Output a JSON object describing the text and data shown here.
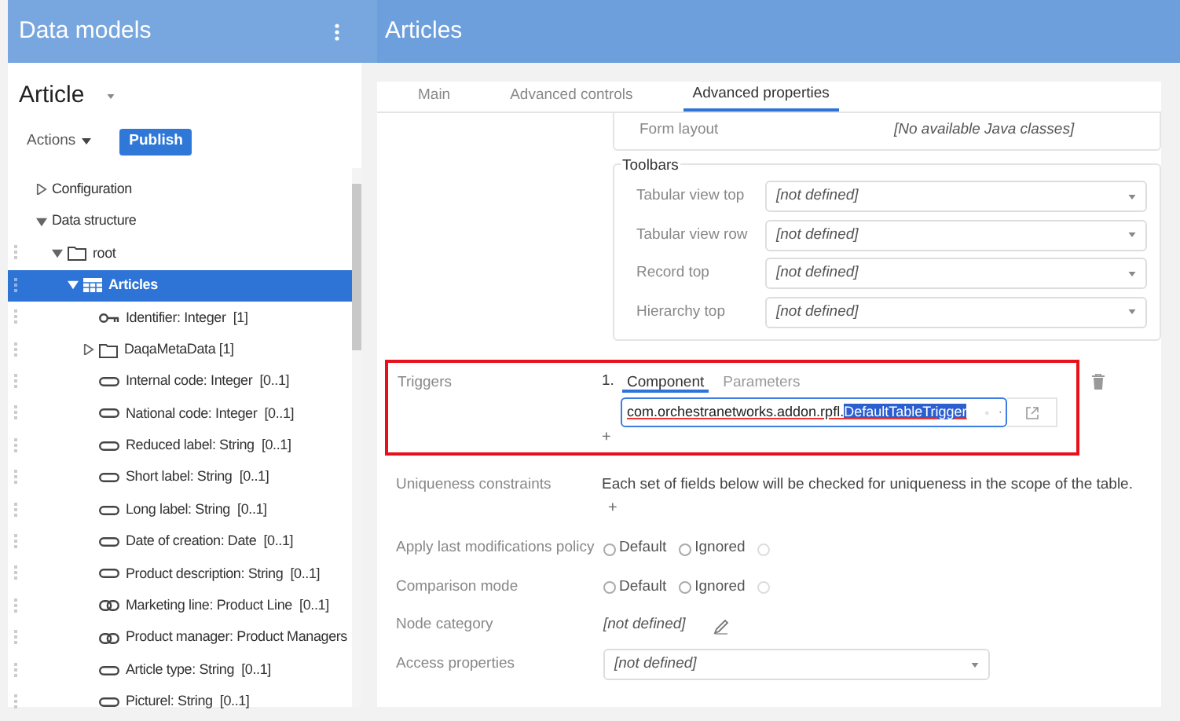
{
  "sidebar": {
    "title": "Data models",
    "model": {
      "name": "Article"
    },
    "actions": {
      "label": "Actions"
    },
    "publish": {
      "label": "Publish"
    },
    "tree": [
      {
        "label": "Configuration",
        "kind": "group",
        "expanded": false,
        "selected": false
      },
      {
        "label": "Data structure",
        "kind": "group",
        "expanded": true,
        "selected": false,
        "children": [
          {
            "label": "root",
            "kind": "folder",
            "expanded": true,
            "selected": false,
            "children": [
              {
                "label": "Articles",
                "kind": "table",
                "expanded": true,
                "selected": true,
                "children": [
                  {
                    "label": "Identifier: Integer  [1]",
                    "kind": "key",
                    "selected": false
                  },
                  {
                    "label": "DaqaMetaData [1]",
                    "kind": "folder",
                    "expanded": false,
                    "selected": false
                  },
                  {
                    "label": "Internal code: Integer  [0..1]",
                    "kind": "field",
                    "selected": false
                  },
                  {
                    "label": "National code: Integer  [0..1]",
                    "kind": "field",
                    "selected": false
                  },
                  {
                    "label": "Reduced label: String  [0..1]",
                    "kind": "field",
                    "selected": false
                  },
                  {
                    "label": "Short label: String  [0..1]",
                    "kind": "field",
                    "selected": false
                  },
                  {
                    "label": "Long label: String  [0..1]",
                    "kind": "field",
                    "selected": false
                  },
                  {
                    "label": "Date of creation: Date  [0..1]",
                    "kind": "field",
                    "selected": false
                  },
                  {
                    "label": "Product description: String  [0..1]",
                    "kind": "field",
                    "selected": false
                  },
                  {
                    "label": "Marketing line: Product Line  [0..1]",
                    "kind": "link",
                    "selected": false
                  },
                  {
                    "label": "Product manager: Product Managers",
                    "kind": "link",
                    "selected": false
                  },
                  {
                    "label": "Article type: String  [0..1]",
                    "kind": "field",
                    "selected": false
                  },
                  {
                    "label": "Picturel: String  [0..1]",
                    "kind": "field",
                    "selected": false
                  }
                ]
              }
            ]
          }
        ]
      }
    ]
  },
  "main": {
    "title": "Articles",
    "tabs": [
      {
        "label": "Main",
        "selected": false
      },
      {
        "label": "Advanced controls",
        "selected": false
      },
      {
        "label": "Advanced properties",
        "selected": true
      }
    ],
    "form_layout": {
      "label": "Form layout",
      "value": "[No available Java classes]"
    },
    "toolbars": {
      "legend": "Toolbars",
      "rows": [
        {
          "label": "Tabular view top",
          "value": "[not defined]"
        },
        {
          "label": "Tabular view row",
          "value": "[not defined]"
        },
        {
          "label": "Record top",
          "value": "[not defined]"
        },
        {
          "label": "Hierarchy top",
          "value": "[not defined]"
        }
      ]
    },
    "triggers": {
      "label": "Triggers",
      "highlighted": true,
      "items": [
        {
          "number": "1.",
          "tabs": [
            {
              "label": "Component",
              "selected": true
            },
            {
              "label": "Parameters",
              "selected": false
            }
          ],
          "value_parts": [
            {
              "text": "com.orchestranetworks.addon.rpfl.",
              "selected": false
            },
            {
              "text": "DefaultTableTrigger",
              "selected": true
            }
          ],
          "add": "+"
        }
      ]
    },
    "uniqueness": {
      "label": "Uniqueness constraints",
      "text": "Each set of fields below will be checked for uniqueness in the scope of the table.",
      "add": "+"
    },
    "radio_rows": [
      {
        "label": "Apply last modifications policy",
        "options": [
          {
            "label": "Default",
            "selected": false
          },
          {
            "label": "Ignored",
            "selected": false
          },
          {
            "selected": false
          }
        ]
      },
      {
        "label": "Comparison mode",
        "options": [
          {
            "label": "Default",
            "selected": false
          },
          {
            "label": "Ignored",
            "selected": false
          },
          {
            "selected": false
          }
        ]
      }
    ],
    "node_category": {
      "label": "Node category",
      "value": "[not defined]"
    },
    "access_properties": {
      "label": "Access properties",
      "value": "[not defined]"
    }
  }
}
